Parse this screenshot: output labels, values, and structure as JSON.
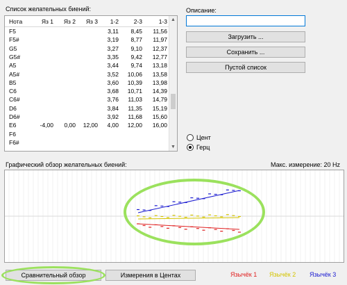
{
  "labels": {
    "wish_list": "Список желательных биений:",
    "description": "Описание:",
    "graph_overview": "Графический обзор желательных биений:",
    "max_measure": "Макс. измерение: 20 Hz"
  },
  "table": {
    "columns": [
      "Нота",
      "Яз 1",
      "Яз 2",
      "Яз 3",
      "1-2",
      "2-3",
      "1-3"
    ],
    "rows": [
      [
        "F5",
        "",
        "",
        "",
        "3,11",
        "8,45",
        "11,56"
      ],
      [
        "F5#",
        "",
        "",
        "",
        "3,19",
        "8,77",
        "11,97"
      ],
      [
        "G5",
        "",
        "",
        "",
        "3,27",
        "9,10",
        "12,37"
      ],
      [
        "G5#",
        "",
        "",
        "",
        "3,35",
        "9,42",
        "12,77"
      ],
      [
        "A5",
        "",
        "",
        "",
        "3,44",
        "9,74",
        "13,18"
      ],
      [
        "A5#",
        "",
        "",
        "",
        "3,52",
        "10,06",
        "13,58"
      ],
      [
        "B5",
        "",
        "",
        "",
        "3,60",
        "10,39",
        "13,98"
      ],
      [
        "C6",
        "",
        "",
        "",
        "3,68",
        "10,71",
        "14,39"
      ],
      [
        "C6#",
        "",
        "",
        "",
        "3,76",
        "11,03",
        "14,79"
      ],
      [
        "D6",
        "",
        "",
        "",
        "3,84",
        "11,35",
        "15,19"
      ],
      [
        "D6#",
        "",
        "",
        "",
        "3,92",
        "11,68",
        "15,60"
      ],
      [
        "E6",
        "-4,00",
        "0,00",
        "12,00",
        "4,00",
        "12,00",
        "16,00"
      ],
      [
        "F6",
        "",
        "",
        "",
        "",
        "",
        ""
      ],
      [
        "F6#",
        "",
        "",
        "",
        "",
        "",
        ""
      ]
    ]
  },
  "buttons": {
    "load": "Загрузить ...",
    "save": "Сохранить ...",
    "empty_list": "Пустой список",
    "comparative": "Сравнительный обзор",
    "cents": "Измерения в Центах"
  },
  "description_value": "",
  "radios": {
    "cent": "Цент",
    "hertz": "Герц",
    "selected": "hertz"
  },
  "legend": [
    {
      "label": "Язычёк 1",
      "color": "#e02020"
    },
    {
      "label": "Язычёк 2",
      "color": "#d4c400"
    },
    {
      "label": "Язычёк 3",
      "color": "#1a1ad0"
    }
  ],
  "annotation_color": "#9be15d"
}
